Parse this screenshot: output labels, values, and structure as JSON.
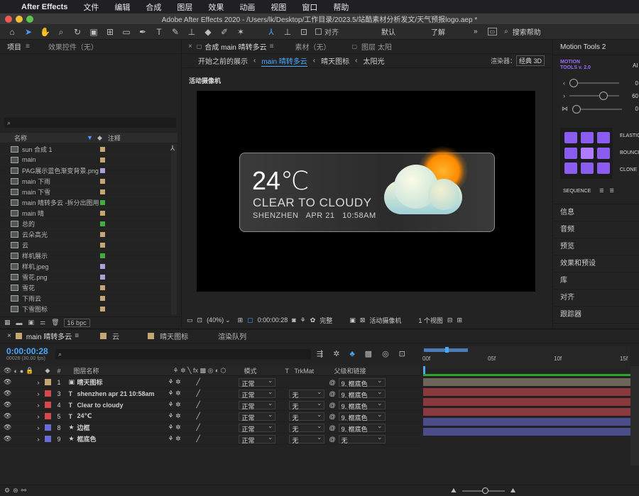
{
  "menubar": {
    "apple": "",
    "app": "After Effects",
    "items": [
      "文件",
      "编辑",
      "合成",
      "图层",
      "效果",
      "动画",
      "视图",
      "窗口",
      "帮助"
    ]
  },
  "title": "Adobe After Effects 2020 - /Users/lk/Desktop/工作目录/2023.5/站酷素材分析发文/天气预报logo.aep *",
  "toolbar": {
    "align": "对齐",
    "default": "默认",
    "learn": "了解",
    "search_placeholder": "搜索帮助"
  },
  "project": {
    "tab": "项目",
    "effects_tab": "效果控件（无）",
    "search_icon": "search",
    "col_name": "名称",
    "col_label": "注释",
    "items": [
      {
        "name": "sun 合成 1",
        "color": "#c6a673"
      },
      {
        "name": "main",
        "color": "#c6a673"
      },
      {
        "name": "PAG展示蓝色渐变背景.png",
        "color": "#a7a2d9"
      },
      {
        "name": "main 下雨",
        "color": "#c6a673"
      },
      {
        "name": "main 下雪",
        "color": "#c6a673"
      },
      {
        "name": "main 晴转多云 -拆分出图用",
        "color": "#3fad3f"
      },
      {
        "name": "main 晴",
        "color": "#c6a673"
      },
      {
        "name": "总的",
        "color": "#3fad3f"
      },
      {
        "name": "云朵高光",
        "color": "#c6a673"
      },
      {
        "name": "云",
        "color": "#c6a673"
      },
      {
        "name": "样机展示",
        "color": "#3fad3f"
      },
      {
        "name": "样机.jpeg",
        "color": "#a7a2d9"
      },
      {
        "name": "雪花.png",
        "color": "#a7a2d9"
      },
      {
        "name": "雪花",
        "color": "#c6a673"
      },
      {
        "name": "下雨云",
        "color": "#c6a673"
      },
      {
        "name": "下雪图标",
        "color": "#c6a673"
      }
    ],
    "bpc": "16 bpc"
  },
  "comp": {
    "tab": "合成 main 晴转多云",
    "footage_tab": "素材（无）",
    "layer_tab": "图层 太阳",
    "breadcrumbs": [
      "开始之前的展示",
      "main 晴转多云",
      "晴天图标",
      "太阳光"
    ],
    "renderer_label": "渲染器：",
    "renderer": "经典 3D",
    "camera_label": "活动摄像机",
    "widget": {
      "temp": "24℃",
      "cond": "CLEAR TO CLOUDY",
      "loc": "SHENZHEN   APR 21   10:58AM"
    },
    "footer": {
      "zoom": "(40%)",
      "time": "0:00:00:28",
      "quality": "完整",
      "camera": "活动摄像机",
      "views": "1 个视图"
    }
  },
  "right": {
    "motion_tools": "Motion Tools 2",
    "mt_logo": "MOTION TOOLS v. 2.0",
    "ai": "AI",
    "vals": [
      "0",
      "60",
      "0"
    ],
    "btns": [
      "ELASTIC",
      "BOUNCE",
      "CLONE"
    ],
    "sequence": "SEQUENCE",
    "panels": [
      "信息",
      "音频",
      "预览",
      "效果和预设",
      "库",
      "对齐",
      "跟踪器"
    ]
  },
  "timeline": {
    "tabs": [
      "main 晴转多云",
      "云",
      "晴天图标",
      "渲染队列"
    ],
    "time": "0:00:00:28",
    "fps": "00028 (30.00 fps)",
    "cols": {
      "name": "图层名称",
      "mode": "模式",
      "t": "T",
      "trkmat": "TrkMat",
      "parent": "父级和链接"
    },
    "ruler": [
      "00f",
      "05f",
      "10f",
      "15f"
    ],
    "layers": [
      {
        "num": "1",
        "name": "晴天图标",
        "type": "comp",
        "color": "#c6a673",
        "mode": "正常",
        "trk": "",
        "parent": "9. 框底色",
        "bar": "#6d6557"
      },
      {
        "num": "3",
        "name": "shenzhen  apr 21  10:58am",
        "type": "T",
        "color": "#d24a4a",
        "mode": "正常",
        "trk": "无",
        "parent": "9. 框底色",
        "bar": "#8a3a3e"
      },
      {
        "num": "4",
        "name": "Clear to cloudy",
        "type": "T",
        "color": "#d24a4a",
        "mode": "正常",
        "trk": "无",
        "parent": "9. 框底色",
        "bar": "#8a3a3e"
      },
      {
        "num": "5",
        "name": "24℃",
        "type": "T",
        "color": "#d24a4a",
        "mode": "正常",
        "trk": "无",
        "parent": "9. 框底色",
        "bar": "#8a3a3e"
      },
      {
        "num": "8",
        "name": "边框",
        "type": "star",
        "color": "#6a6ad8",
        "mode": "正常",
        "trk": "无",
        "parent": "9. 框底色",
        "bar": "#4b4c8a"
      },
      {
        "num": "9",
        "name": "框底色",
        "type": "star",
        "color": "#6a6ad8",
        "mode": "正常",
        "trk": "无",
        "parent": "无",
        "bar": "#4b4c8a"
      }
    ]
  }
}
